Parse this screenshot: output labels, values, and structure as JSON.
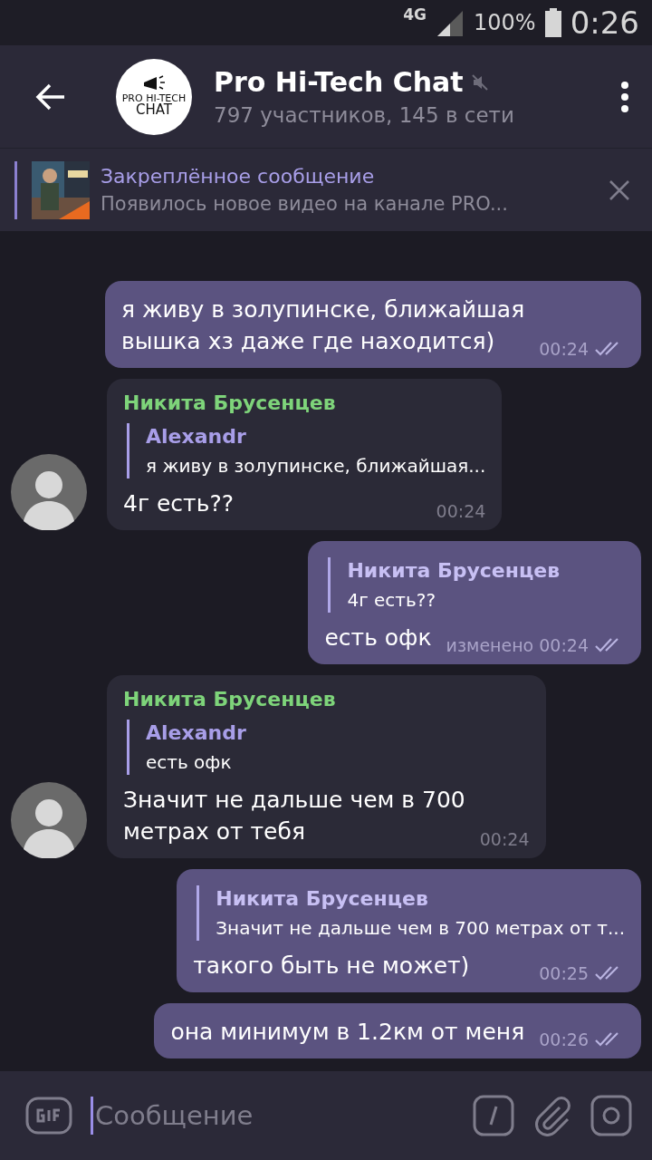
{
  "status_bar": {
    "network": "4G",
    "battery": "100%",
    "time": "0:26"
  },
  "header": {
    "logo_text": [
      "PRO HI-TECH",
      "CHAT"
    ],
    "title": "Pro Hi-Tech Chat",
    "muted": true,
    "subtitle": "797 участников, 145 в сети"
  },
  "pinned": {
    "title": "Закреплённое сообщение",
    "text": "Появилось новое видео на канале PRO..."
  },
  "messages": [
    {
      "kind": "out",
      "text": "я живу в золупинске, ближайшая\nвышка хз даже где находится)",
      "time": "00:24",
      "read": true
    },
    {
      "kind": "in",
      "sender": "Никита Брусенцев",
      "reply": {
        "name": "Alexandr",
        "text": "я живу в золупинске, ближайшая..."
      },
      "text": "4г есть??",
      "time": "00:24"
    },
    {
      "kind": "out",
      "reply": {
        "name": "Никита Брусенцев",
        "text": "4г есть??"
      },
      "text": "есть офк",
      "edited": "изменено",
      "time": "00:24",
      "read": true
    },
    {
      "kind": "in",
      "sender": "Никита Брусенцев",
      "reply": {
        "name": "Alexandr",
        "text": "есть офк"
      },
      "text": "Значит не дальше чем в 700\nметрах от тебя",
      "time": "00:24"
    },
    {
      "kind": "out",
      "reply": {
        "name": "Никита Брусенцев",
        "text": "Значит не дальше чем в 700 метрах от т..."
      },
      "text": "такого быть не может)",
      "time": "00:25",
      "read": true
    },
    {
      "kind": "out",
      "text": "она минимум в 1.2км от меня",
      "time": "00:26",
      "read": true
    }
  ],
  "composer": {
    "placeholder": "Сообщение"
  }
}
